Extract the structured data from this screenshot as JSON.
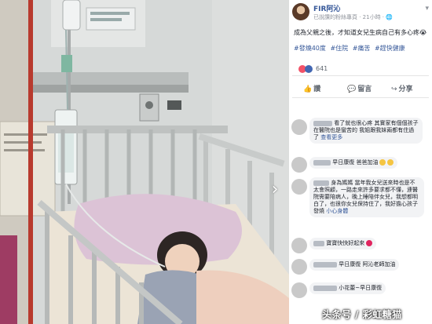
{
  "post": {
    "author": "FIR阿沁",
    "meta": "已說讚的粉絲專頁 · 21小時 · 🌐",
    "text": "成為父親之後，才知道女兒生病自己有多心疼😭",
    "hashtags": [
      "#發燒40度",
      "#住院",
      "#痛苦",
      "#趕快健康"
    ],
    "reaction_count": "641",
    "actions": {
      "like": "讚",
      "comment": "留言",
      "share": "分享"
    }
  },
  "comments": [
    {
      "name": "",
      "text": "看了就也很心疼 其實家有個個孩子在醫院也是蠻苦的 我姐跟我妹兩都有住過了",
      "more": "查看更多"
    },
    {
      "name": "",
      "text": "早日康復 爸爸加油",
      "emoji": "💪"
    },
    {
      "name": "",
      "text": "身為媽媽 當年我女兒送來時也是不太會照顧，一路走來許多要求都不懂，連醫院需要陪病人，晚上睡陪伴女兒，我想都明白了，也很你女兒保持住了，我好擔心孩子發燒",
      "more": "小心身體"
    },
    {
      "name": "",
      "text": "寶寶快快好起來"
    },
    {
      "name": "",
      "text": "早日康復 阿沁老師加油"
    },
    {
      "name": "",
      "text": "小花蕾~早日康復"
    }
  ],
  "watermark": "头条号 / 彩虹糖猫"
}
